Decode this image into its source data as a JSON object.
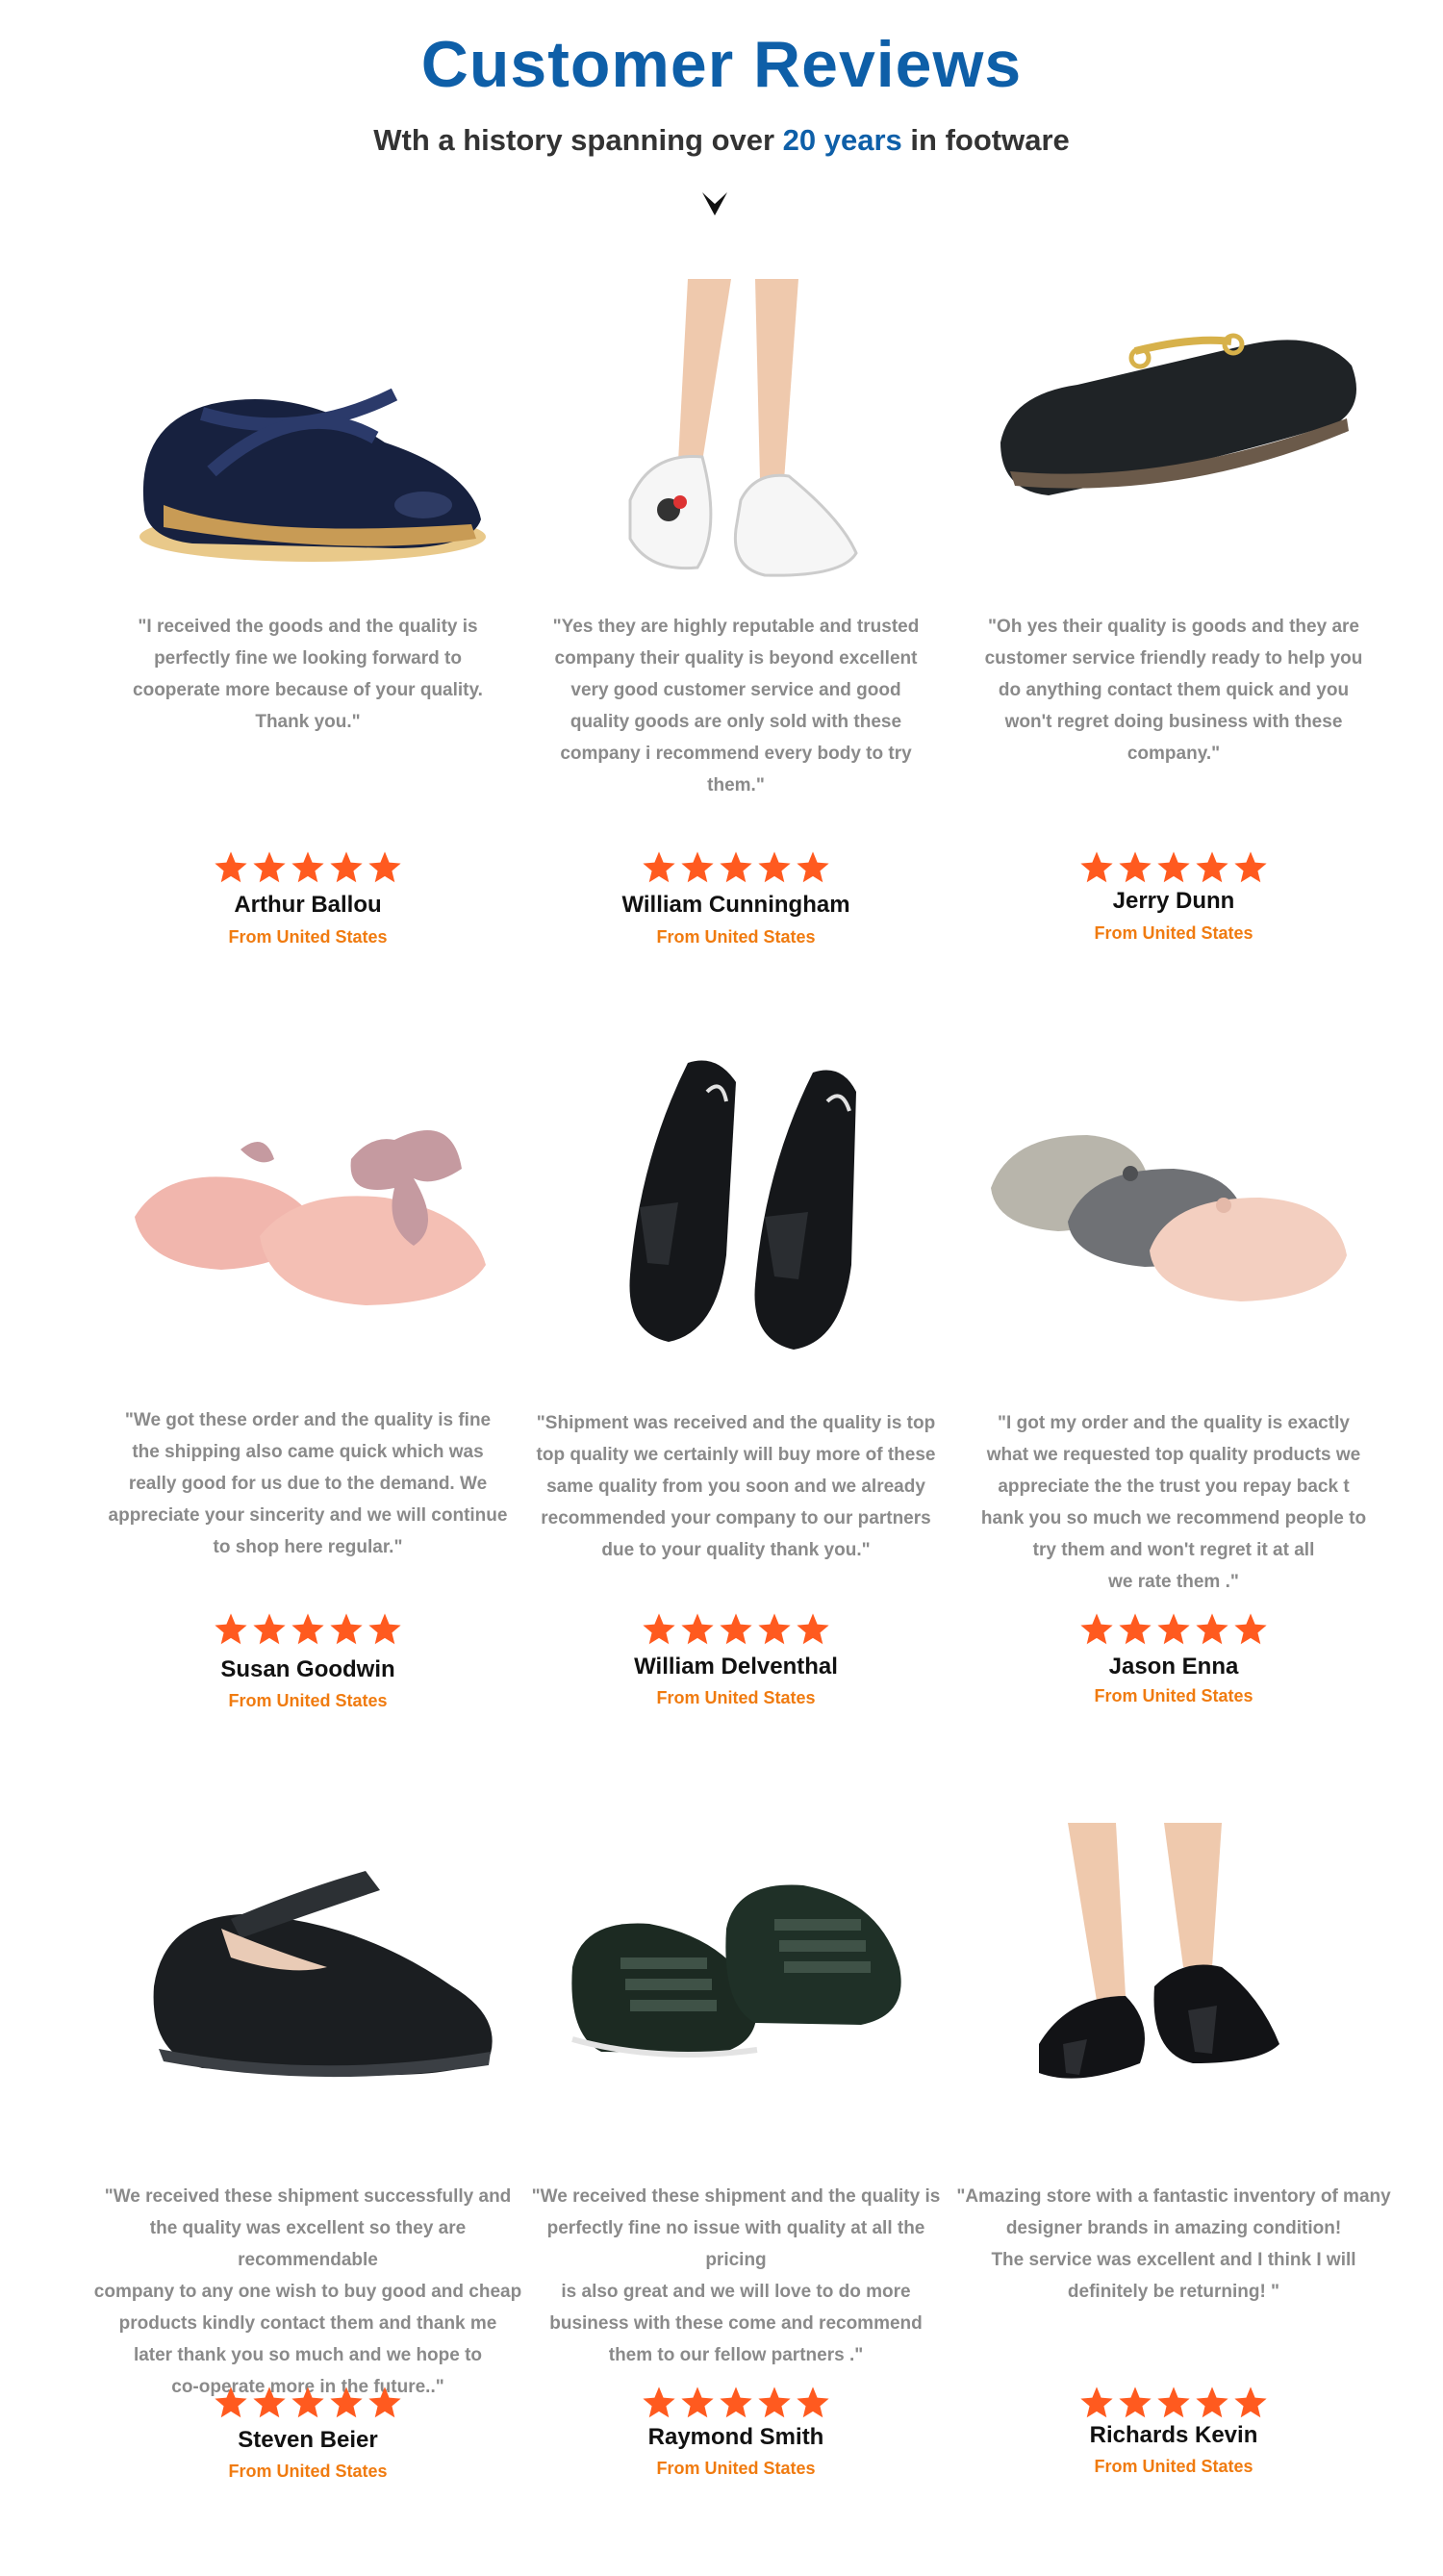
{
  "header": {
    "title": "Customer Reviews",
    "subtitle_before": "Wth a history spanning over ",
    "subtitle_highlight": "20 years",
    "subtitle_after": " in footware",
    "arrow_icon": "down-arrow-icon"
  },
  "colors": {
    "title": "#0e5fa8",
    "highlight": "#0e5fa8",
    "star": "#ff5a1f",
    "origin": "#f07b10",
    "quote": "#8a8a8a"
  },
  "reviews": [
    {
      "image": "navy-patent-mary-jane-shoe",
      "quote_lines": [
        "\"I received the goods and the quality is",
        "perfectly fine we looking forward to",
        "cooperate more because of your quality.",
        "Thank you.\""
      ],
      "rating": 5,
      "name": "Arthur Ballou",
      "origin": "From United States"
    },
    {
      "image": "white-sneakers-on-legs",
      "quote_lines": [
        "\"Yes they are highly reputable and trusted",
        "company their quality is beyond excellent",
        "very good customer service and good",
        "quality goods are only sold with these",
        "company i recommend every body to try",
        "them.\""
      ],
      "rating": 5,
      "name": "William Cunningham",
      "origin": "From United States"
    },
    {
      "image": "black-leather-loafer-with-buckle",
      "quote_lines": [
        "\"Oh yes their quality is goods and they are",
        "customer service friendly ready to help you",
        "do anything contact them quick and you",
        "won't regret doing business with these",
        "company.\""
      ],
      "rating": 5,
      "name": "Jerry Dunn",
      "origin": "From United States"
    },
    {
      "image": "pink-patent-bow-flats",
      "quote_lines": [
        "\"We got these order and the quality is fine",
        "the shipping also came quick which was",
        "really good for us due to the demand. We",
        "appreciate your sincerity and we will continue",
        "to shop here regular.\""
      ],
      "rating": 5,
      "name": "Susan Goodwin",
      "origin": "From United States"
    },
    {
      "image": "black-patent-tassel-loafers",
      "quote_lines": [
        "\"Shipment was received and the quality is top",
        "top quality we certainly will buy more of these",
        "same quality from you soon and we already",
        "recommended your company to our partners",
        "due to your quality thank you.\""
      ],
      "rating": 5,
      "name": "William Delventhal",
      "origin": "From United States"
    },
    {
      "image": "metallic-grey-pink-mary-janes",
      "quote_lines": [
        "\"I got my order and the quality is exactly",
        "what we requested top quality products we",
        "appreciate the the trust you repay back t",
        "hank you so much we recommend people to",
        "try them and won't regret it at all",
        "we rate them .\""
      ],
      "rating": 5,
      "name": "Jason Enna",
      "origin": "From United States"
    },
    {
      "image": "black-school-mary-jane-shoe",
      "quote_lines": [
        "\"We received these shipment successfully and",
        "the quality was excellent so they are recommendable",
        "company to any one wish to buy good and cheap",
        "products kindly contact them and thank me",
        "later thank you so much and we hope to",
        "co-operate more in the future..\""
      ],
      "rating": 5,
      "name": "Steven Beier",
      "origin": "From United States"
    },
    {
      "image": "black-velcro-sneakers",
      "quote_lines": [
        "\"We received these shipment and the quality is",
        "perfectly fine no issue with quality at all the pricing",
        "is also great and we will love to do more",
        "business with these come and recommend",
        "them to our fellow partners .\""
      ],
      "rating": 5,
      "name": "Raymond Smith",
      "origin": "From United States"
    },
    {
      "image": "black-patent-tassel-loafers-on-legs",
      "quote_lines": [
        "\"Amazing store with a fantastic inventory of many",
        "designer brands in amazing condition!",
        "The service was excellent and I think I will",
        "definitely be returning! \""
      ],
      "rating": 5,
      "name": "Richards Kevin",
      "origin": "From United States"
    }
  ]
}
